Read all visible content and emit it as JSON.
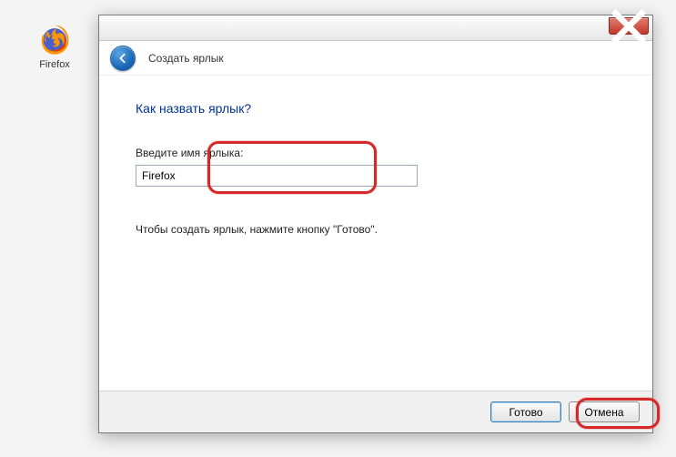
{
  "desktop": {
    "firefox_label": "Firefox"
  },
  "dialog": {
    "wizard_title": "Создать ярлык",
    "heading": "Как назвать ярлык?",
    "field_label": "Введите имя ярлыка:",
    "name_value": "Firefox",
    "instruction": "Чтобы создать ярлык, нажмите кнопку \"Готово\".",
    "buttons": {
      "finish": "Готово",
      "cancel": "Отмена"
    }
  }
}
